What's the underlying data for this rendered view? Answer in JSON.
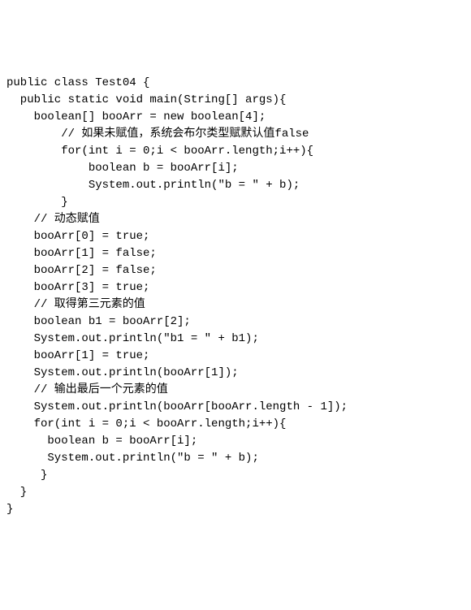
{
  "code": {
    "lines": [
      "public class Test04 {",
      "  public static void main(String[] args){",
      "    boolean[] booArr = new boolean[4];",
      "        // 如果未赋值，系统会布尔类型赋默认值false",
      "        for(int i = 0;i < booArr.length;i++){",
      "            boolean b = booArr[i];",
      "            System.out.println(\"b = \" + b);",
      "        }",
      "    // 动态赋值",
      "    booArr[0] = true;",
      "    booArr[1] = false;",
      "    booArr[2] = false;",
      "    booArr[3] = true;",
      "    // 取得第三元素的值",
      "    boolean b1 = booArr[2];",
      "    System.out.println(\"b1 = \" + b1);",
      "    booArr[1] = true;",
      "    System.out.println(booArr[1]);",
      "    // 输出最后一个元素的值",
      "    System.out.println(booArr[booArr.length - 1]);",
      "    for(int i = 0;i < booArr.length;i++){",
      "      boolean b = booArr[i];",
      "      System.out.println(\"b = \" + b);",
      "     }",
      "  }",
      "}"
    ]
  }
}
